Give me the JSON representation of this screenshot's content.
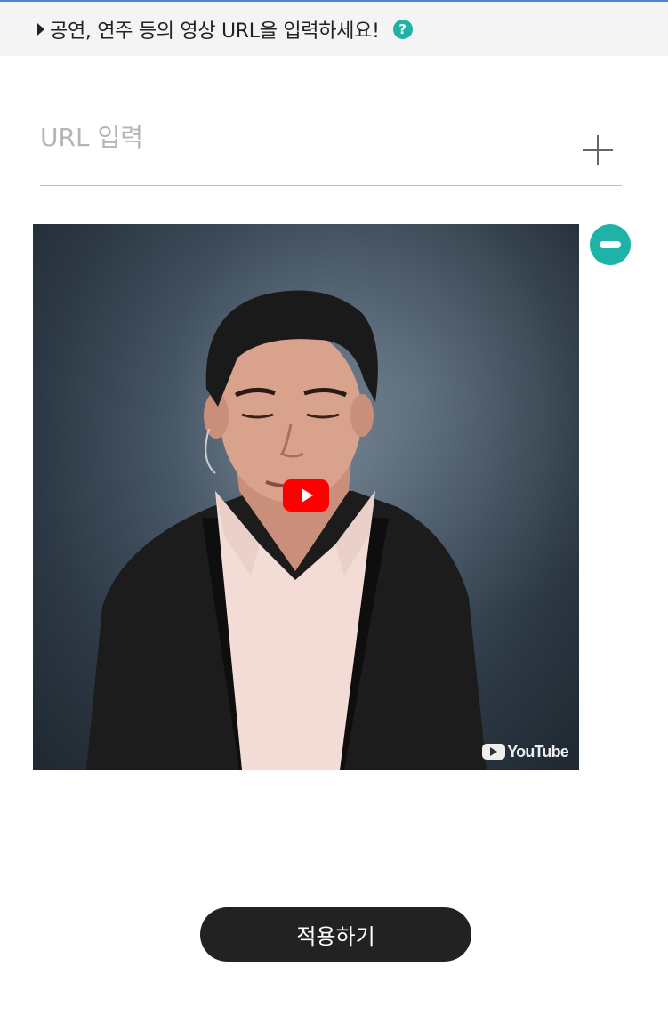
{
  "header": {
    "title": "공연, 연주 등의 영상 URL을 입력하세요!",
    "help_icon_glyph": "?",
    "help_icon_color": "#1fb2a6"
  },
  "url_field": {
    "value": "",
    "placeholder": "URL 입력",
    "add_icon": "plus-icon"
  },
  "video": {
    "provider_label": "YouTube",
    "play_icon": "youtube-play-icon",
    "remove_icon": "minus-circle-icon",
    "play_color": "#ff0000"
  },
  "footer": {
    "apply_label": "적용하기"
  },
  "colors": {
    "accent": "#1fb2a6",
    "button_dark": "#222222"
  }
}
